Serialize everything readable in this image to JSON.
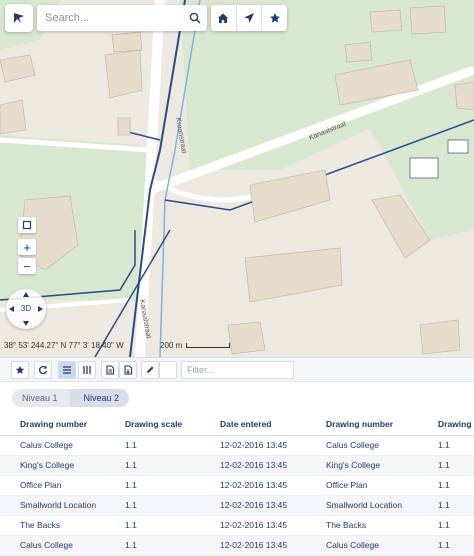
{
  "search": {
    "placeholder": "Search..."
  },
  "map": {
    "road_labels": [
      "Kanaalstraat",
      "Kroonstraat",
      "Kanaalstraat"
    ],
    "coordinates": "38° 53' 244.27\" N   77° 3' 18.40\" W",
    "scale_label": "200 m",
    "compass_label": "3D"
  },
  "toolbar_icons": [
    "logo-icon",
    "search-icon",
    "home-icon",
    "locate-icon",
    "star-icon"
  ],
  "panel": {
    "filter_placeholder": "Filter...",
    "breadcrumbs": [
      "Niveau 1",
      "Niveau 2"
    ],
    "columns": [
      "Drawing number",
      "Drawing scale",
      "Date entered",
      "Drawing number",
      "Drawing scale"
    ],
    "rows": [
      [
        "Calus College",
        "1.1",
        "12-02-2016 13:45",
        "Calus College",
        "1.1"
      ],
      [
        "King's College",
        "1.1",
        "12-02-2016 13:45",
        "King's College",
        "1.1"
      ],
      [
        "Office Plan",
        "1.1",
        "12-02-2016 13:45",
        "Office Plan",
        "1.1"
      ],
      [
        "Smallworld Location",
        "1.1",
        "12-02-2016 13:45",
        "Smallworld Location",
        "1.1"
      ],
      [
        "The Backs",
        "1.1",
        "12-02-2016 13:45",
        "The Backs",
        "1.1"
      ],
      [
        "Calus College",
        "1.1",
        "12-02-2016 13:45",
        "Calus College",
        "1.1"
      ]
    ]
  },
  "colors": {
    "accent": "#1f3b73",
    "park": "#d6e5cc",
    "road": "#ffffff",
    "water": "#7fb2e0",
    "building": "#e6dccb"
  }
}
